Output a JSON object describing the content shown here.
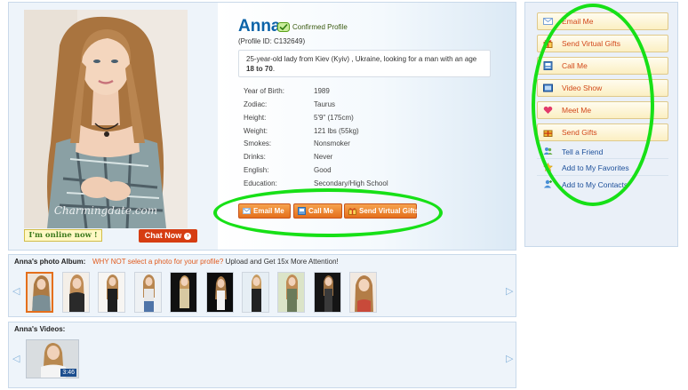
{
  "profile": {
    "name": "Anna",
    "confirmed_label": "Confirmed Profile",
    "profile_id": "(Profile ID: C132649)",
    "intro_text": "25-year-old lady from Kiev (Kyiv) , Ukraine, looking for a man with an age ",
    "intro_age_from": "18 to",
    "intro_age_to": "70",
    "intro_end": ".",
    "photo_watermark": "Charmingdate.com",
    "online_label": "I'm online now !",
    "chat_label": "Chat Now",
    "facts": [
      {
        "label": "Year of Birth:",
        "value": "1989"
      },
      {
        "label": "Zodiac:",
        "value": "Taurus"
      },
      {
        "label": "Height:",
        "value": "5'9\" (175cm)"
      },
      {
        "label": "Weight:",
        "value": "121 lbs (55kg)"
      },
      {
        "label": "Smokes:",
        "value": "Nonsmoker"
      },
      {
        "label": "Drinks:",
        "value": "Never"
      },
      {
        "label": "English:",
        "value": "Good"
      },
      {
        "label": "Education:",
        "value": "Secondary/High School"
      }
    ],
    "actions": {
      "email": "Email Me",
      "call": "Call Me",
      "gifts": "Send Virtual Gifts"
    }
  },
  "menu": {
    "buttons": [
      {
        "label": "Email Me",
        "icon": "envelope-icon"
      },
      {
        "label": "Send Virtual Gifts",
        "icon": "gift-icon"
      },
      {
        "label": "Call Me",
        "icon": "phone-icon"
      },
      {
        "label": "Video Show",
        "icon": "video-icon"
      },
      {
        "label": "Meet Me",
        "icon": "heart-icon"
      },
      {
        "label": "Send Gifts",
        "icon": "present-icon"
      }
    ],
    "links": [
      {
        "label": "Tell a Friend",
        "icon": "people-icon"
      },
      {
        "label": "Add to My Favorites",
        "icon": "star-icon"
      },
      {
        "label": "Add to My Contacts",
        "icon": "contact-icon"
      }
    ]
  },
  "album": {
    "title": "Anna's photo Album:",
    "warning": "WHY NOT select a photo for your profile?",
    "upload_text": "Upload and Get 15x More Attention!",
    "photo_count": 10
  },
  "videos": {
    "title": "Anna's Videos:",
    "items": [
      {
        "duration": "3:46"
      }
    ]
  },
  "colors": {
    "annotation": "#17e017",
    "name_blue": "#0c63a8",
    "button_orange": "#e46f1c",
    "menu_text": "#d2481a",
    "link_blue": "#1c4f9a"
  }
}
